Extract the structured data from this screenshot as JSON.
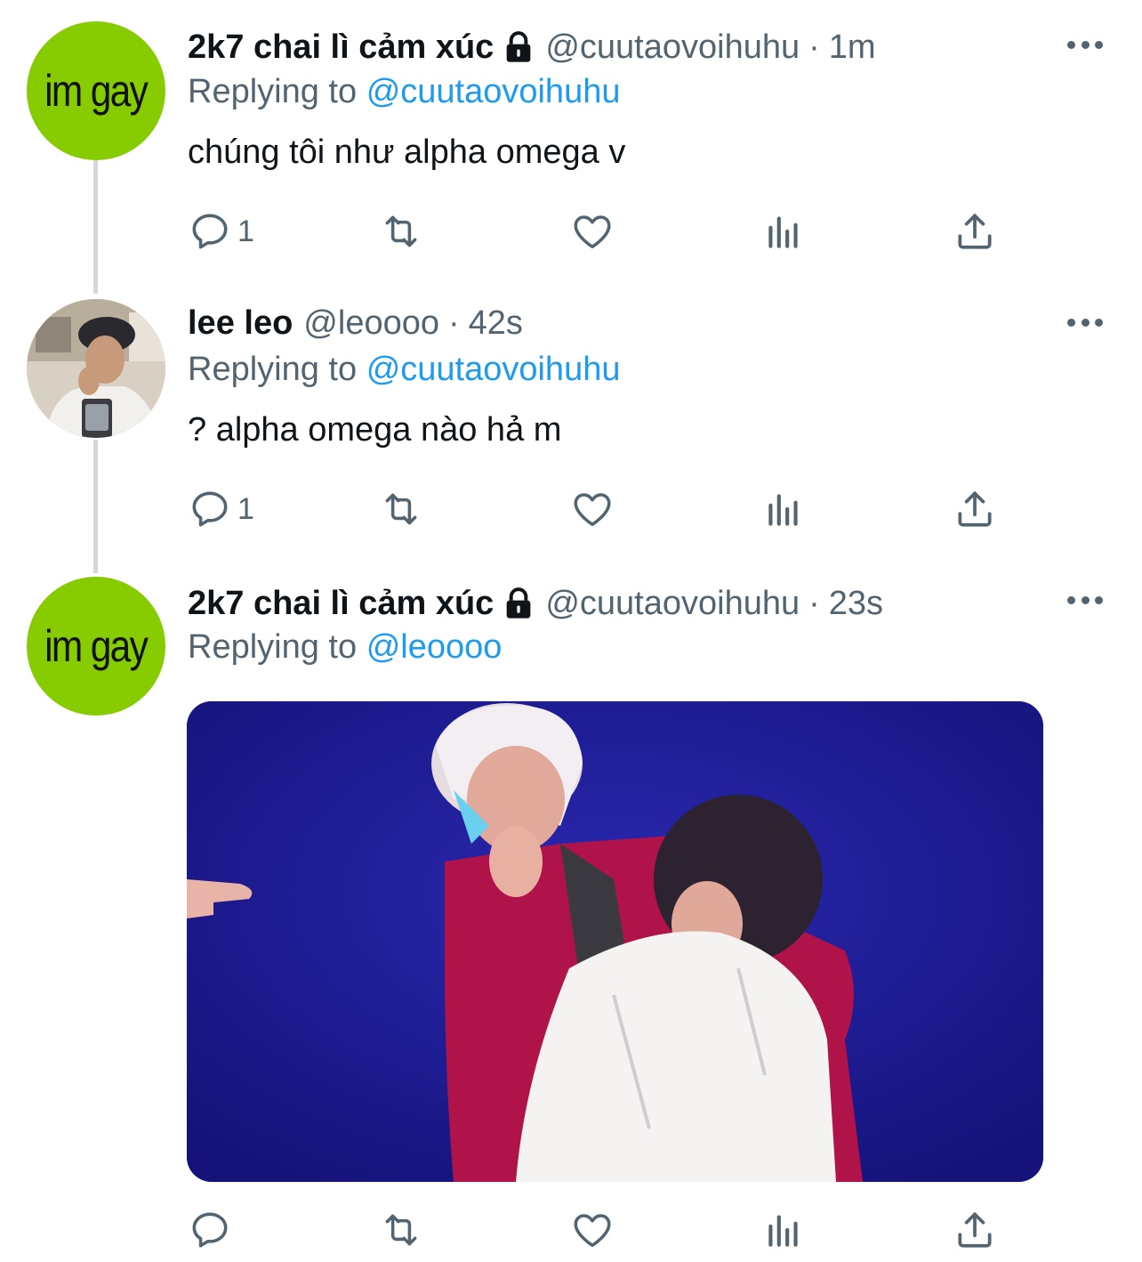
{
  "tweets": [
    {
      "avatar_text": "im gay",
      "name": "2k7 chai lì cảm xúc",
      "handle": "@cuutaovoihuhu",
      "separator": "·",
      "time": "1m",
      "replying_prefix": "Replying to",
      "replying_to": "@cuutaovoihuhu",
      "text": "chúng tôi như alpha omega v",
      "reply_count": "1",
      "locked": true
    },
    {
      "name": "lee leo",
      "handle": "@leoooo",
      "separator": "·",
      "time": "42s",
      "replying_prefix": "Replying to",
      "replying_to": "@cuutaovoihuhu",
      "text": "? alpha omega nào hả m",
      "reply_count": "1",
      "locked": false
    },
    {
      "avatar_text": "im gay",
      "name": "2k7 chai lì cảm xúc",
      "handle": "@cuutaovoihuhu",
      "separator": "·",
      "time": "23s",
      "replying_prefix": "Replying to",
      "replying_to": "@leoooo",
      "reply_count": "",
      "locked": true
    }
  ],
  "icons": {
    "reply": "reply-icon",
    "retweet": "retweet-icon",
    "like": "like-icon",
    "analytics": "analytics-icon",
    "share": "share-icon",
    "more": "more-icon",
    "lock": "lock-icon"
  },
  "colors": {
    "link": "#1d9bf0",
    "secondary_text": "#536471",
    "avatar_green": "#86cc00",
    "media_background": "#1c1a92"
  }
}
